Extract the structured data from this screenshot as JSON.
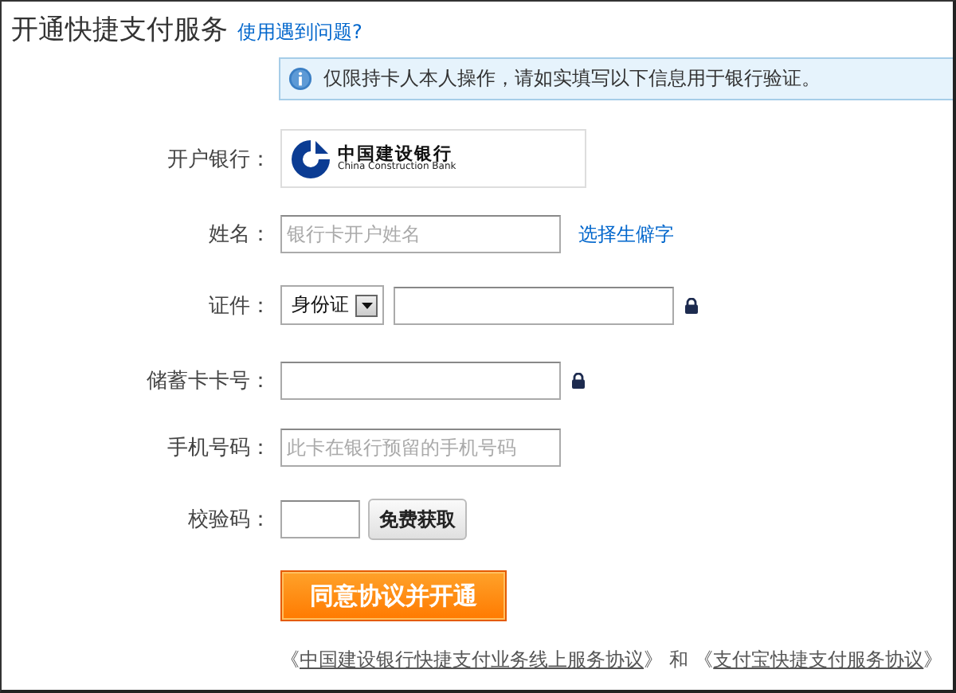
{
  "header": {
    "title": "开通快捷支付服务",
    "help_link": "使用遇到问题?"
  },
  "notice": "仅限持卡人本人操作，请如实填写以下信息用于银行验证。",
  "fields": [
    {
      "kind": "bank",
      "label": "开户银行：",
      "bank_name": "中国建设银行",
      "bank_name_en": "China Construction Bank"
    },
    {
      "kind": "text",
      "label": "姓名：",
      "placeholder": "银行卡开户姓名",
      "link": "选择生僻字",
      "secure": false
    },
    {
      "kind": "id",
      "label": "证件：",
      "select_value": "身份证",
      "secure": true
    },
    {
      "kind": "text",
      "label": "储蓄卡卡号：",
      "secure": true
    },
    {
      "kind": "text",
      "label": "手机号码：",
      "placeholder": "此卡在银行预留的手机号码",
      "secure": false
    },
    {
      "kind": "code",
      "label": "校验码：",
      "button": "免费获取"
    }
  ],
  "submit": "同意协议并开通",
  "agreements": {
    "open_mark": "《",
    "close_mark": "》",
    "conjunction": "和",
    "links": [
      "中国建设银行快捷支付业务线上服务协议",
      "支付宝快捷支付服务协议"
    ]
  }
}
